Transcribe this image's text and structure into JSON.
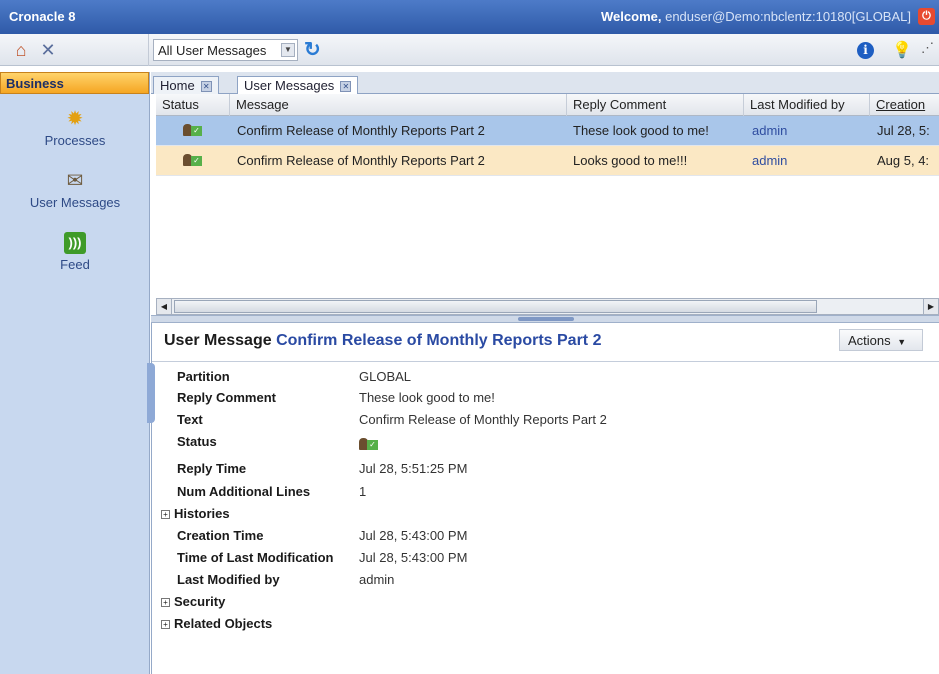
{
  "titlebar": {
    "app_name": "Cronacle 8",
    "welcome_label": "Welcome,",
    "welcome_user": "enduser@Demo:nbclentz:10180[GLOBAL]"
  },
  "toolbar": {
    "message_filter": "All User Messages",
    "icons": [
      "home-icon",
      "tools-icon",
      "refresh-icon",
      "info-icon",
      "bulb-icon"
    ]
  },
  "sidebar": {
    "header": "Business",
    "items": [
      {
        "label": "Processes",
        "icon": "gear-icon"
      },
      {
        "label": "User Messages",
        "icon": "user-message-icon"
      },
      {
        "label": "Feed",
        "icon": "rss-feed-icon"
      }
    ]
  },
  "tabs": [
    {
      "label": "Home"
    },
    {
      "label": "User Messages",
      "active": true
    }
  ],
  "grid": {
    "columns": [
      "Status",
      "Message",
      "Reply Comment",
      "Last Modified by",
      "Creation"
    ],
    "rows": [
      {
        "message": "Confirm Release of Monthly Reports Part 2",
        "reply_comment": "These look good to me!",
        "last_modified_by": "admin",
        "creation": "Jul 28, 5:",
        "selected": true
      },
      {
        "message": "Confirm Release of Monthly Reports Part 2",
        "reply_comment": "Looks good to me!!!",
        "last_modified_by": "admin",
        "creation": "Aug 5, 4:"
      }
    ]
  },
  "detail": {
    "title_prefix": "User Message",
    "title": "Confirm Release of Monthly Reports Part 2",
    "actions_label": "Actions",
    "fields": {
      "partition_label": "Partition",
      "partition": "GLOBAL",
      "reply_comment_label": "Reply Comment",
      "reply_comment": "These look good to me!",
      "text_label": "Text",
      "text": "Confirm Release of Monthly Reports Part 2",
      "status_label": "Status",
      "reply_time_label": "Reply Time",
      "reply_time": "Jul 28, 5:51:25 PM",
      "num_lines_label": "Num Additional Lines",
      "num_lines": "1",
      "histories_label": "Histories",
      "creation_time_label": "Creation Time",
      "creation_time": "Jul 28, 5:43:00 PM",
      "last_mod_time_label": "Time of Last Modification",
      "last_mod_time": "Jul 28, 5:43:00 PM",
      "last_modified_by_label": "Last Modified by",
      "last_modified_by": "admin",
      "security_label": "Security",
      "related_label": "Related Objects"
    }
  },
  "colors": {
    "titlebar": "#3a64b3",
    "sidebar": "#c8d8ef",
    "selected_row": "#a9c6ea",
    "alt_row": "#fbe8c4",
    "link": "#2f4da0"
  }
}
